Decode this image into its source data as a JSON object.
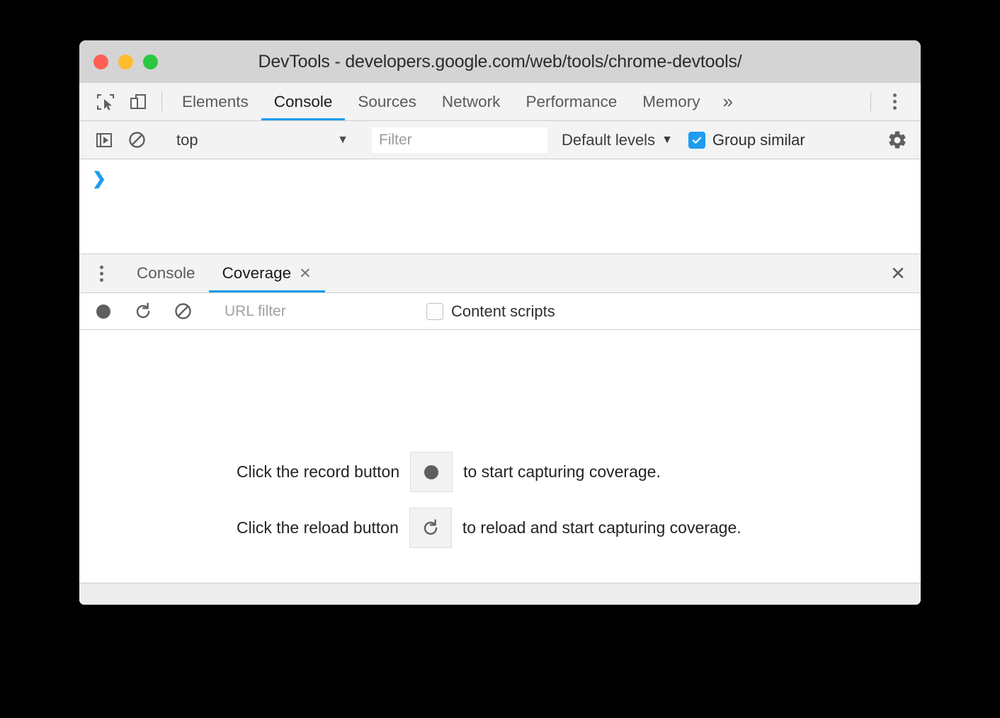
{
  "window": {
    "title": "DevTools - developers.google.com/web/tools/chrome-devtools/",
    "traffic_lights": [
      {
        "name": "close",
        "color": "#ff5f56"
      },
      {
        "name": "minimize",
        "color": "#febc2e"
      },
      {
        "name": "maximize",
        "color": "#28c840"
      }
    ]
  },
  "main_tabbar": {
    "inspect_icon": "inspect-element-icon",
    "device_icon": "device-toolbar-icon",
    "tabs": [
      {
        "label": "Elements",
        "active": false
      },
      {
        "label": "Console",
        "active": true
      },
      {
        "label": "Sources",
        "active": false
      },
      {
        "label": "Network",
        "active": false
      },
      {
        "label": "Performance",
        "active": false
      },
      {
        "label": "Memory",
        "active": false
      }
    ],
    "overflow_label": "»",
    "more_icon": "more-vertical-icon",
    "active_underline_color": "#1e9cf0"
  },
  "console_toolbar": {
    "sidebar_icon": "show-console-sidebar-icon",
    "clear_icon": "clear-console-icon",
    "context_value": "top",
    "context_caret": "▼",
    "filter_placeholder": "Filter",
    "filter_value": "",
    "levels_label": "Default levels",
    "levels_caret": "▼",
    "group_similar_label": "Group similar",
    "group_similar_checked": true,
    "settings_icon": "gear-icon",
    "checkbox_color": "#1e9cf0"
  },
  "console_output": {
    "prompt_chevron": "❯",
    "prompt_color": "#1e9cf0",
    "entries": []
  },
  "drawer": {
    "more_icon": "more-vertical-icon",
    "tabs": [
      {
        "label": "Console",
        "active": false,
        "closable": false
      },
      {
        "label": "Coverage",
        "active": true,
        "closable": true,
        "close_glyph": "✕"
      }
    ],
    "close_glyph": "✕",
    "active_underline_color": "#1e9cf0"
  },
  "coverage_toolbar": {
    "record_icon": "record-circle-icon",
    "reload_icon": "reload-icon",
    "clear_icon": "clear-icon",
    "url_filter_placeholder": "URL filter",
    "url_filter_value": "",
    "content_scripts_label": "Content scripts",
    "content_scripts_checked": false
  },
  "coverage_body": {
    "hints": [
      {
        "prefix": "Click the record button",
        "icon": "record-circle-icon",
        "suffix": "to start capturing coverage."
      },
      {
        "prefix": "Click the reload button",
        "icon": "reload-icon",
        "suffix": "to reload and start capturing coverage."
      }
    ]
  },
  "statusbar": {
    "text": ""
  }
}
